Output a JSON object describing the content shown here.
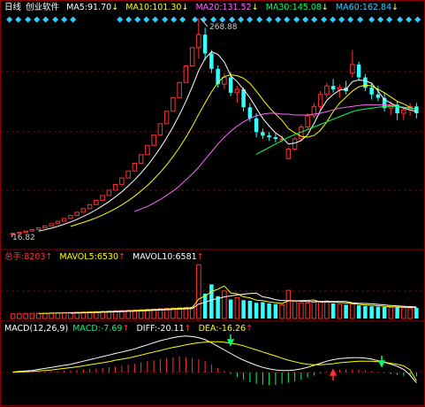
{
  "main": {
    "period_label": "日线",
    "stock_name": "创业软件",
    "ma": [
      {
        "label": "MA5:",
        "value": "91.70",
        "arrow": "↓",
        "color": "#ffffff"
      },
      {
        "label": "MA10:",
        "value": "101.30",
        "arrow": "↓",
        "color": "#ffff00"
      },
      {
        "label": "MA20:",
        "value": "131.52",
        "arrow": "↓",
        "color": "#ff66ff"
      },
      {
        "label": "MA30:",
        "value": "145.08",
        "arrow": "↓",
        "color": "#00ff66"
      },
      {
        "label": "MA60:",
        "value": "162.84",
        "arrow": "↓",
        "color": "#33ccff"
      }
    ],
    "high_label": "268.88",
    "low_label": "16.82"
  },
  "volume": {
    "total_label": "总手:",
    "total_value": "8203",
    "total_arrow": "↑",
    "mavol5_label": "MAVOL5:",
    "mavol5_value": "6530",
    "mavol5_arrow": "↑",
    "mavol10_label": "MAVOL10:",
    "mavol10_value": "6581",
    "mavol10_arrow": "↑"
  },
  "macd": {
    "title": "MACD(12,26,9)",
    "macd_label": "MACD:",
    "macd_value": "-7.69",
    "macd_arrow": "↑",
    "diff_label": "DIFF:",
    "diff_value": "-20.11",
    "diff_arrow": "↑",
    "dea_label": "DEA:",
    "dea_value": "-16.26",
    "dea_arrow": "↑"
  },
  "colors": {
    "up": "#ff3333",
    "down": "#33ffff",
    "ma5": "#ffffff",
    "ma10": "#ffff00",
    "ma20": "#ff66ff",
    "ma30": "#00ff66",
    "grid": "#8a0000"
  },
  "chart_data": {
    "type": "candlestick",
    "series": [
      {
        "type": "candles",
        "values": [
          {
            "o": 16.8,
            "h": 17.5,
            "l": 16.8,
            "c": 17.5
          },
          {
            "o": 17.5,
            "h": 18.7,
            "l": 17.5,
            "c": 18.7
          },
          {
            "o": 18.7,
            "h": 20.2,
            "l": 18.7,
            "c": 20.2
          },
          {
            "o": 20.2,
            "h": 21.9,
            "l": 20.2,
            "c": 21.9
          },
          {
            "o": 21.9,
            "h": 23.9,
            "l": 21.9,
            "c": 23.9
          },
          {
            "o": 23.9,
            "h": 26.2,
            "l": 23.9,
            "c": 26.2
          },
          {
            "o": 26.2,
            "h": 28.8,
            "l": 26.2,
            "c": 28.8
          },
          {
            "o": 28.8,
            "h": 31.7,
            "l": 28.8,
            "c": 31.7
          },
          {
            "o": 31.7,
            "h": 34.9,
            "l": 31.7,
            "c": 34.9
          },
          {
            "o": 34.9,
            "h": 38.4,
            "l": 34.9,
            "c": 38.4
          },
          {
            "o": 38.4,
            "h": 42.2,
            "l": 38.4,
            "c": 42.2
          },
          {
            "o": 42.2,
            "h": 46.4,
            "l": 42.2,
            "c": 46.4
          },
          {
            "o": 46.4,
            "h": 51.1,
            "l": 46.4,
            "c": 51.1
          },
          {
            "o": 51.1,
            "h": 56.2,
            "l": 51.1,
            "c": 56.2
          },
          {
            "o": 56.2,
            "h": 61.8,
            "l": 56.2,
            "c": 61.8
          },
          {
            "o": 61.8,
            "h": 68.0,
            "l": 61.8,
            "c": 68.0
          },
          {
            "o": 68.0,
            "h": 74.8,
            "l": 68.0,
            "c": 74.8
          },
          {
            "o": 74.8,
            "h": 82.3,
            "l": 74.8,
            "c": 82.3
          },
          {
            "o": 82.3,
            "h": 90.5,
            "l": 82.3,
            "c": 90.5
          },
          {
            "o": 90.5,
            "h": 99.6,
            "l": 90.5,
            "c": 99.6
          },
          {
            "o": 99.6,
            "h": 109.5,
            "l": 99.6,
            "c": 109.5
          },
          {
            "o": 109.5,
            "h": 120.5,
            "l": 109.5,
            "c": 120.5
          },
          {
            "o": 120.5,
            "h": 132.5,
            "l": 120.5,
            "c": 132.5
          },
          {
            "o": 132.5,
            "h": 145.8,
            "l": 132.5,
            "c": 145.8
          },
          {
            "o": 145.8,
            "h": 160.4,
            "l": 145.8,
            "c": 160.4
          },
          {
            "o": 160.4,
            "h": 176.4,
            "l": 160.4,
            "c": 176.4
          },
          {
            "o": 176.4,
            "h": 194.0,
            "l": 176.4,
            "c": 194.0
          },
          {
            "o": 194.0,
            "h": 213.4,
            "l": 194.0,
            "c": 213.4
          },
          {
            "o": 213.4,
            "h": 234.8,
            "l": 213.4,
            "c": 234.8
          },
          {
            "o": 234.8,
            "h": 268.9,
            "l": 222.0,
            "c": 250.0
          },
          {
            "o": 250.0,
            "h": 258.0,
            "l": 220.0,
            "c": 228.0
          },
          {
            "o": 228.0,
            "h": 232.0,
            "l": 205.0,
            "c": 210.0
          },
          {
            "o": 210.0,
            "h": 214.0,
            "l": 188.0,
            "c": 192.0
          },
          {
            "o": 192.0,
            "h": 205.0,
            "l": 186.0,
            "c": 200.0
          },
          {
            "o": 200.0,
            "h": 206.0,
            "l": 178.0,
            "c": 182.0
          },
          {
            "o": 182.0,
            "h": 190.0,
            "l": 170.0,
            "c": 186.0
          },
          {
            "o": 186.0,
            "h": 188.0,
            "l": 160.0,
            "c": 165.0
          },
          {
            "o": 165.0,
            "h": 170.0,
            "l": 148.0,
            "c": 152.0
          },
          {
            "o": 152.0,
            "h": 158.0,
            "l": 130.0,
            "c": 136.0
          },
          {
            "o": 136.0,
            "h": 140.0,
            "l": 128.0,
            "c": 132.0
          },
          {
            "o": 132.0,
            "h": 136.0,
            "l": 126.0,
            "c": 130.0
          },
          {
            "o": 130.0,
            "h": 134.0,
            "l": 124.0,
            "c": 128.0
          },
          {
            "o": 128.0,
            "h": 132.0,
            "l": 124.0,
            "c": 128.0
          },
          {
            "o": 105.0,
            "h": 118.0,
            "l": 104.0,
            "c": 116.0
          },
          {
            "o": 116.0,
            "h": 130.0,
            "l": 114.0,
            "c": 128.0
          },
          {
            "o": 128.0,
            "h": 145.0,
            "l": 126.0,
            "c": 142.0
          },
          {
            "o": 142.0,
            "h": 158.0,
            "l": 140.0,
            "c": 155.0
          },
          {
            "o": 155.0,
            "h": 170.0,
            "l": 152.0,
            "c": 166.0
          },
          {
            "o": 166.0,
            "h": 184.0,
            "l": 162.0,
            "c": 180.0
          },
          {
            "o": 180.0,
            "h": 194.0,
            "l": 175.0,
            "c": 190.0
          },
          {
            "o": 190.0,
            "h": 198.0,
            "l": 182.0,
            "c": 186.0
          },
          {
            "o": 186.0,
            "h": 192.0,
            "l": 176.0,
            "c": 188.0
          },
          {
            "o": 188.0,
            "h": 196.0,
            "l": 180.0,
            "c": 184.0
          },
          {
            "o": 205.0,
            "h": 232.0,
            "l": 200.0,
            "c": 215.0
          },
          {
            "o": 215.0,
            "h": 218.0,
            "l": 196.0,
            "c": 200.0
          },
          {
            "o": 200.0,
            "h": 204.0,
            "l": 184.0,
            "c": 188.0
          },
          {
            "o": 188.0,
            "h": 194.0,
            "l": 174.0,
            "c": 180.0
          },
          {
            "o": 180.0,
            "h": 190.0,
            "l": 172.0,
            "c": 176.0
          },
          {
            "o": 176.0,
            "h": 182.0,
            "l": 160.0,
            "c": 164.0
          },
          {
            "o": 164.0,
            "h": 172.0,
            "l": 156.0,
            "c": 168.0
          },
          {
            "o": 168.0,
            "h": 172.0,
            "l": 150.0,
            "c": 158.0
          },
          {
            "o": 158.0,
            "h": 165.0,
            "l": 150.0,
            "c": 162.0
          },
          {
            "o": 162.0,
            "h": 170.0,
            "l": 155.0,
            "c": 166.0
          },
          {
            "o": 166.0,
            "h": 170.0,
            "l": 152.0,
            "c": 158.0
          }
        ]
      }
    ],
    "ma": {
      "ma5": [
        null,
        null,
        null,
        null,
        20.0,
        21.7,
        23.6,
        25.7,
        28.1,
        30.8,
        33.9,
        37.3,
        41.0,
        45.2,
        49.7,
        54.7,
        60.2,
        66.2,
        72.9,
        80.2,
        88.2,
        97.0,
        106.7,
        117.4,
        129.2,
        142.1,
        156.3,
        171.9,
        189.1,
        208.0,
        222.0,
        230.0,
        227.0,
        218.0,
        202.0,
        195.0,
        186.0,
        176.0,
        164.0,
        152.0,
        143.0,
        135.0,
        130.0,
        122.0,
        123.0,
        126.0,
        133.0,
        146.0,
        161.0,
        173.0,
        180.0,
        185.0,
        186.0,
        195.0,
        197.0,
        196.0,
        193.0,
        184.0,
        174.0,
        170.0,
        166.0,
        164.0,
        162.0,
        160.0
      ],
      "ma10": [
        null,
        null,
        null,
        null,
        null,
        null,
        null,
        null,
        null,
        25.6,
        28.0,
        30.3,
        32.9,
        35.7,
        38.9,
        42.5,
        46.4,
        50.8,
        55.6,
        61.0,
        67.0,
        73.6,
        80.9,
        88.9,
        97.7,
        107.4,
        118.1,
        129.8,
        142.7,
        156.8,
        170.0,
        183.0,
        194.0,
        201.0,
        203.0,
        202.0,
        199.0,
        193.0,
        184.0,
        174.0,
        165.0,
        157.0,
        150.0,
        140.0,
        135.0,
        131.0,
        130.0,
        132.0,
        138.0,
        148.0,
        160.0,
        170.0,
        177.0,
        184.0,
        189.0,
        191.0,
        190.0,
        186.0,
        182.0,
        177.0,
        172.0,
        169.0,
        165.0,
        162.0
      ],
      "ma20": [
        null,
        null,
        null,
        null,
        null,
        null,
        null,
        null,
        null,
        null,
        null,
        null,
        null,
        null,
        null,
        null,
        null,
        null,
        null,
        43.0,
        46.0,
        49.0,
        53.0,
        57.0,
        62.0,
        67.0,
        73.0,
        80.0,
        87.0,
        95.0,
        104.0,
        113.0,
        122.0,
        130.0,
        137.0,
        143.0,
        148.0,
        152.0,
        155.0,
        157.0,
        158.0,
        158.0,
        157.0,
        157.0,
        156.0,
        156.0,
        156.0,
        157.0,
        158.0,
        160.0,
        162.0,
        164.0,
        165.0,
        166.0,
        167.0,
        168.0,
        168.0,
        168.0,
        168.0,
        167.0,
        166.0,
        165.0,
        164.0,
        163.0
      ],
      "ma30": [
        null,
        null,
        null,
        null,
        null,
        null,
        null,
        null,
        null,
        null,
        null,
        null,
        null,
        null,
        null,
        null,
        null,
        null,
        null,
        null,
        null,
        null,
        null,
        null,
        null,
        null,
        null,
        null,
        null,
        null,
        null,
        null,
        null,
        null,
        null,
        null,
        null,
        null,
        110.0,
        114.0,
        118.0,
        122.0,
        126.0,
        130.0,
        133.0,
        136.0,
        139.0,
        142.0,
        145.0,
        148.0,
        151.0,
        154.0,
        157.0,
        160.0,
        162.0,
        163.0,
        164.0,
        165.0,
        166.0,
        166.0,
        166.0,
        165.0,
        164.0,
        163.0
      ]
    },
    "volume": [
      700,
      720,
      760,
      780,
      800,
      820,
      860,
      880,
      900,
      930,
      960,
      1000,
      1030,
      1060,
      1100,
      1140,
      1180,
      1220,
      1260,
      1300,
      1350,
      1400,
      1450,
      1500,
      1550,
      1600,
      1650,
      1700,
      1750,
      8203,
      3800,
      5200,
      3400,
      4200,
      2900,
      3200,
      2800,
      2700,
      2400,
      2500,
      2300,
      2200,
      2100,
      4300,
      2600,
      2400,
      2400,
      2500,
      2600,
      2700,
      2300,
      2200,
      2100,
      2200,
      2000,
      1900,
      1850,
      1800,
      1750,
      1700,
      1700,
      1650,
      1600,
      1600
    ],
    "macd": [
      0.5,
      0.8,
      1.1,
      1.4,
      1.7,
      2.0,
      2.5,
      3.0,
      3.6,
      4.2,
      5.0,
      5.8,
      6.8,
      7.8,
      9.0,
      10.5,
      12.0,
      13.5,
      15.0,
      17.0,
      19.5,
      22.0,
      24.0,
      26.0,
      28.0,
      30.0,
      31.0,
      30.0,
      28.0,
      26.0,
      22.0,
      16.0,
      9.0,
      3.0,
      -3.0,
      -9.0,
      -14.0,
      -19.0,
      -22.0,
      -24.0,
      -25.0,
      -24.0,
      -22.0,
      -20.0,
      -17.0,
      -14.0,
      -10.0,
      -6.0,
      -2.0,
      1.5,
      4.0,
      5.5,
      6.0,
      6.0,
      5.5,
      4.5,
      3.0,
      1.0,
      -1.0,
      -3.0,
      -5.0,
      -6.5,
      -7.5,
      -7.69
    ],
    "diff": [
      1,
      2,
      3,
      4,
      6,
      8,
      10,
      12,
      14,
      16,
      19,
      22,
      25,
      28,
      31,
      34,
      37,
      40,
      43,
      46,
      50,
      54,
      58,
      62,
      65,
      68,
      70,
      71,
      70,
      68,
      64,
      58,
      51,
      44,
      37,
      30,
      24,
      19,
      14,
      10,
      7,
      5,
      4,
      4,
      5,
      7,
      10,
      14,
      18,
      22,
      25,
      27,
      28,
      29,
      29,
      28,
      26,
      23,
      20,
      16,
      12,
      6,
      -5,
      -20.11
    ],
    "dea": [
      0.5,
      1,
      1.5,
      2,
      3,
      4,
      5,
      6.5,
      8,
      9.5,
      11,
      13,
      15,
      17,
      19,
      21,
      24,
      26,
      28,
      31,
      34,
      37,
      40,
      43,
      46,
      49,
      51,
      54,
      56,
      58,
      59,
      60,
      60,
      59,
      57,
      55,
      52,
      48,
      44,
      40,
      36,
      32,
      28,
      24,
      21,
      18,
      16,
      15,
      15,
      16,
      17,
      19,
      20,
      21,
      22,
      22,
      22,
      21,
      20,
      18,
      16,
      13,
      5,
      -16.26
    ]
  }
}
